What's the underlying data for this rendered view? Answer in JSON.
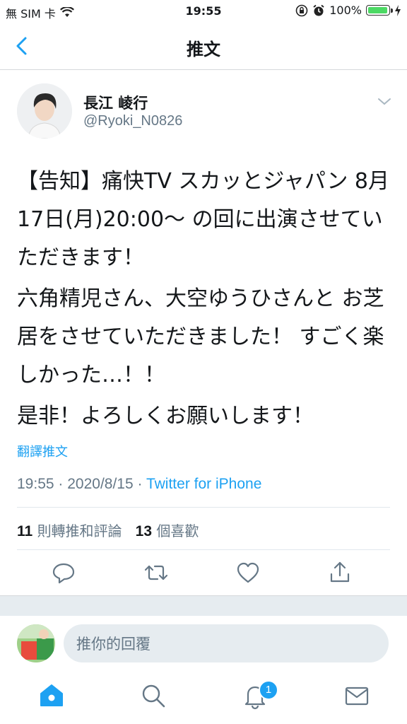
{
  "status_bar": {
    "carrier": "無 SIM 卡",
    "time": "19:55",
    "battery_percent": "100%",
    "battery_level": 1.0
  },
  "nav": {
    "title": "推文"
  },
  "author": {
    "name": "長江 崚行",
    "handle": "@Ryoki_N0826"
  },
  "tweet": {
    "paragraphs": [
      "【告知】痛快TV スカッとジャパン 8月17日(月)20:00～ の回に出演させていただきます！",
      "六角精児さん、大空ゆうひさんと お芝居をさせていただきました！ すごく楽しかった…！！",
      "是非！よろしくお願いします！"
    ],
    "translate_label": "翻譯推文"
  },
  "meta": {
    "time": "19:55",
    "date": "2020/8/15",
    "source": "Twitter for iPhone"
  },
  "stats": {
    "retweets": "11",
    "retweets_label": "則轉推和評論",
    "likes": "13",
    "likes_label": "個喜歡"
  },
  "reply": {
    "placeholder": "推你的回覆"
  },
  "tabbar": {
    "notification_count": "1"
  },
  "colors": {
    "accent": "#1da1f2",
    "muted": "#657786",
    "divider": "#e1e8ed",
    "battery": "#4cd964"
  },
  "icons": [
    "wifi-icon",
    "alarm-icon",
    "lock-rotation-icon",
    "battery-icon",
    "charging-icon",
    "back-chevron-icon",
    "chevron-down-icon",
    "reply-icon",
    "retweet-icon",
    "like-icon",
    "share-icon",
    "home-icon",
    "search-icon",
    "bell-icon",
    "mail-icon"
  ]
}
